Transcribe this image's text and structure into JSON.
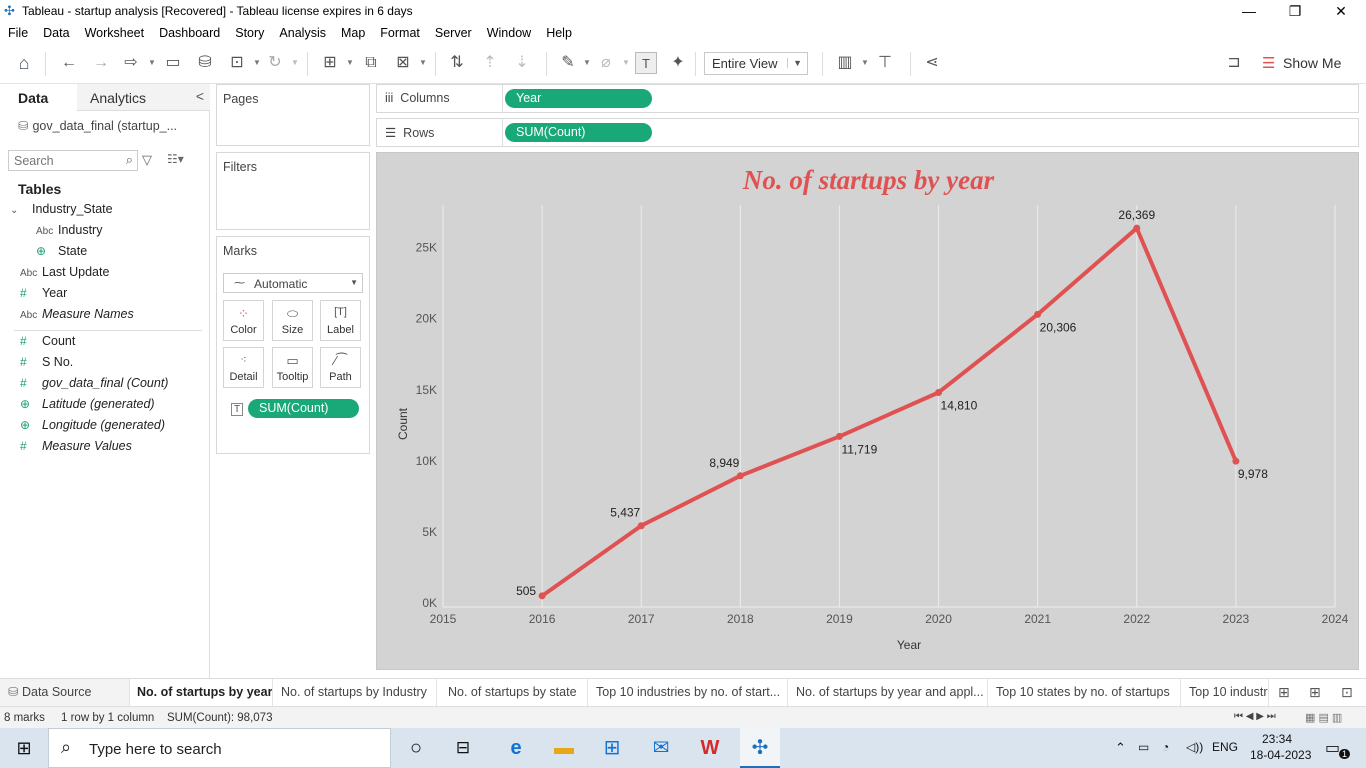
{
  "window": {
    "title": "Tableau - startup analysis [Recovered] - Tableau license expires in 6 days",
    "minimize": "—",
    "restore": "❐",
    "close": "✕"
  },
  "menu": [
    "File",
    "Data",
    "Worksheet",
    "Dashboard",
    "Story",
    "Analysis",
    "Map",
    "Format",
    "Server",
    "Window",
    "Help"
  ],
  "toolbar": {
    "view_select": "Entire View",
    "show_me": "Show Me"
  },
  "data_pane": {
    "tab_data": "Data",
    "tab_analytics": "Analytics",
    "collapse": "<",
    "datasource": "gov_data_final (startup_...",
    "search_placeholder": "Search",
    "tables_heading": "Tables",
    "fields": [
      {
        "icon": "⌄",
        "type": "hier",
        "label": "Industry_State",
        "italic": false
      },
      {
        "icon": "Abc",
        "type": "str",
        "label": "Industry",
        "italic": false
      },
      {
        "icon": "⊕",
        "type": "geo",
        "label": "State",
        "italic": false
      },
      {
        "icon": "Abc",
        "type": "str",
        "label": "Last Update",
        "italic": false
      },
      {
        "icon": "#",
        "type": "num",
        "label": "Year",
        "italic": false
      },
      {
        "icon": "Abc",
        "type": "str",
        "label": "Measure Names",
        "italic": true
      },
      {
        "icon": "#",
        "type": "num",
        "label": "Count",
        "italic": false
      },
      {
        "icon": "#",
        "type": "num",
        "label": "S No.",
        "italic": false
      },
      {
        "icon": "#",
        "type": "num",
        "label": "gov_data_final (Count)",
        "italic": true
      },
      {
        "icon": "⊕",
        "type": "geo",
        "label": "Latitude (generated)",
        "italic": true
      },
      {
        "icon": "⊕",
        "type": "geo",
        "label": "Longitude (generated)",
        "italic": true
      },
      {
        "icon": "#",
        "type": "num",
        "label": "Measure Values",
        "italic": true
      }
    ]
  },
  "cards": {
    "pages": "Pages",
    "filters": "Filters",
    "marks": "Marks",
    "mark_type": "Automatic",
    "mark_buttons": [
      "Color",
      "Size",
      "Label",
      "Detail",
      "Tooltip",
      "Path"
    ],
    "marks_pill": "SUM(Count)"
  },
  "shelves": {
    "columns_label": "Columns",
    "columns_pill": "Year",
    "rows_label": "Rows",
    "rows_pill": "SUM(Count)"
  },
  "chart_data": {
    "type": "line",
    "title": "No. of startups by year",
    "xlabel": "Year",
    "ylabel": "Count",
    "x": [
      2016,
      2017,
      2018,
      2019,
      2020,
      2021,
      2022,
      2023
    ],
    "values": [
      505,
      5437,
      8949,
      11719,
      14810,
      20306,
      26369,
      9978
    ],
    "data_labels": [
      "505",
      "5,437",
      "8,949",
      "11,719",
      "14,810",
      "20,306",
      "26,369",
      "9,978"
    ],
    "xlim": [
      2015,
      2024
    ],
    "ylim": [
      0,
      28000
    ],
    "x_ticks": [
      "2015",
      "2016",
      "2017",
      "2018",
      "2019",
      "2020",
      "2021",
      "2022",
      "2023",
      "2024"
    ],
    "y_ticks": [
      {
        "v": 0,
        "label": "0K"
      },
      {
        "v": 5000,
        "label": "5K"
      },
      {
        "v": 10000,
        "label": "10K"
      },
      {
        "v": 15000,
        "label": "15K"
      },
      {
        "v": 20000,
        "label": "20K"
      },
      {
        "v": 25000,
        "label": "25K"
      }
    ],
    "grid": true,
    "line_color": "#e05252",
    "background": "#d3d3d3"
  },
  "sheet_tabs": {
    "datasource": "Data Source",
    "tabs": [
      "No. of startups by year",
      "No. of startups by Industry",
      "No. of startups by state",
      "Top 10 industries by no. of start...",
      "No. of startups by year and appl...",
      "Top 10 states by no. of startups",
      "Top 10 industr"
    ]
  },
  "status": {
    "marks": "8 marks",
    "rows_cols": "1 row by 1 column",
    "sum": "SUM(Count): 98,073"
  },
  "taskbar": {
    "search_placeholder": "Type here to search",
    "lang": "ENG",
    "time": "23:34",
    "date": "18-04-2023",
    "notifications": "1"
  },
  "colors": {
    "accent_pill": "#19a978",
    "line": "#e05252"
  }
}
